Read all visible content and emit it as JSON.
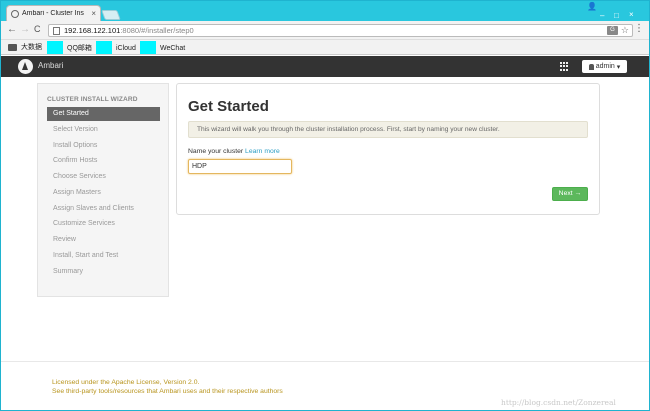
{
  "browser": {
    "tab_title": "Ambari - Cluster Ins",
    "tab_close": "×",
    "user_icon": "👤",
    "minimize": "–",
    "maximize": "□",
    "close": "×",
    "back": "←",
    "forward": "→",
    "reload": "C",
    "url_host": "192.168.122.101",
    "url_path": ":8080/#/installer/step0",
    "translate": "G",
    "star": "☆",
    "menu": "⋮",
    "bookmarks": [
      {
        "label": "大数据",
        "icon": "folder-icon"
      },
      {
        "label": "QQ邮箱",
        "icon": "cyan-square"
      },
      {
        "label": "iCloud",
        "icon": "cyan-square"
      },
      {
        "label": "WeChat",
        "icon": "cyan-square"
      }
    ]
  },
  "header": {
    "brand": "Ambari",
    "user_button": "admin",
    "user_caret": "▾"
  },
  "sidebar": {
    "title": "CLUSTER INSTALL WIZARD",
    "items": [
      {
        "label": "Get Started",
        "active": true
      },
      {
        "label": "Select Version"
      },
      {
        "label": "Install Options"
      },
      {
        "label": "Confirm Hosts"
      },
      {
        "label": "Choose Services"
      },
      {
        "label": "Assign Masters"
      },
      {
        "label": "Assign Slaves and Clients"
      },
      {
        "label": "Customize Services"
      },
      {
        "label": "Review"
      },
      {
        "label": "Install, Start and Test"
      },
      {
        "label": "Summary"
      }
    ]
  },
  "main": {
    "title": "Get Started",
    "alert": "This wizard will walk you through the cluster installation process. First, start by naming your new cluster.",
    "name_label": "Name your cluster",
    "learn_more": "Learn more",
    "cluster_name": "HDP",
    "next_button": "Next →"
  },
  "footer": {
    "line1": "Licensed under the Apache License, Version 2.0.",
    "line2": "See third-party tools/resources that Ambari uses and their respective authors"
  },
  "watermark": "http://blog.csdn.net/Zonzereal",
  "colors": {
    "accent_cyan": "#29c7de",
    "header_dark": "#333333",
    "next_green": "#5cb85c",
    "footer_gold": "#b8951f",
    "link_blue": "#2d9ec3"
  }
}
